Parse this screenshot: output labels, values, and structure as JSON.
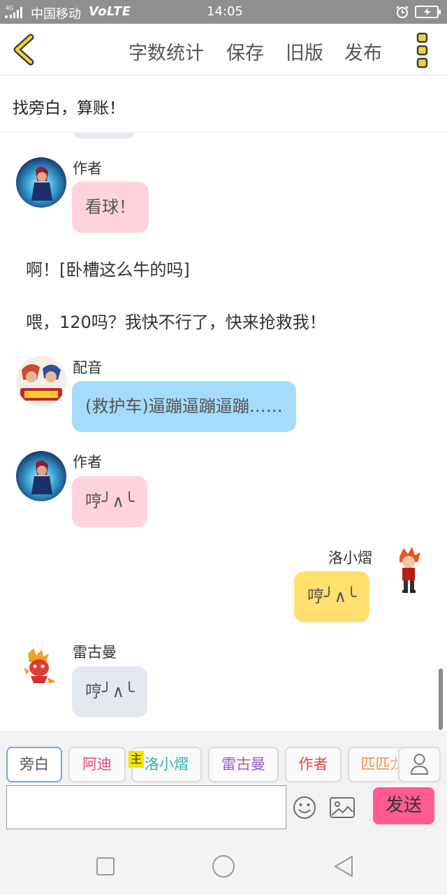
{
  "status_bar": {
    "network": "4G",
    "carrier": "中国移动",
    "volte": "VoLTE",
    "time": "14:05",
    "icons": [
      "signal-icon",
      "alarm-icon",
      "battery-charging-icon"
    ]
  },
  "toolbar": {
    "back_icon": "chevron-left-icon",
    "word_count": "字数统计",
    "save": "保存",
    "old_version": "旧版",
    "publish": "发布",
    "more_icon": "vertical-dots-icon",
    "accent": "#f0d23c"
  },
  "title": "找旁白，算账！",
  "messages": [
    {
      "type": "bubble",
      "side": "left",
      "name": "作者",
      "text": "看球！",
      "color": "#ffd3de",
      "avatar": "author-avatar"
    },
    {
      "type": "narration",
      "text": "啊！[卧槽这么牛的吗]"
    },
    {
      "type": "narration",
      "text": "喂，120吗？我快不行了，快来抢救我！"
    },
    {
      "type": "bubble",
      "side": "left",
      "name": "配音",
      "text": "(救护车)逼蹦逼蹦逼蹦……",
      "color": "#a6dcfb",
      "avatar": "dubbing-avatar"
    },
    {
      "type": "bubble",
      "side": "left",
      "name": "作者",
      "text": "哼╯∧╰",
      "color": "#ffd3de",
      "avatar": "author-avatar"
    },
    {
      "type": "bubble",
      "side": "right",
      "name": "洛小熠",
      "text": "哼╯∧╰",
      "color": "#ffdf6e",
      "avatar": "luoxiaoyi-avatar"
    },
    {
      "type": "bubble",
      "side": "left",
      "name": "雷古曼",
      "text": "哼╯∧╰",
      "color": "#e4e9f0",
      "avatar": "leiguman-avatar"
    }
  ],
  "roles": [
    {
      "label": "旁白",
      "color": "#555555",
      "active": true
    },
    {
      "label": "阿迪",
      "color": "#e0457f"
    },
    {
      "label": "洛小熠",
      "color": "#2bb5b0",
      "main": true
    },
    {
      "label": "雷古曼",
      "color": "#9a5cc8"
    },
    {
      "label": "作者",
      "color": "#e04a3c"
    },
    {
      "label": "匹匹龙",
      "color": "#f08a48"
    }
  ],
  "main_tag": "主",
  "input": {
    "value": "",
    "placeholder": ""
  },
  "send_label": "发送",
  "send_color": "#ff5a92",
  "nav": [
    "recent-apps-icon",
    "home-icon",
    "back-icon"
  ]
}
